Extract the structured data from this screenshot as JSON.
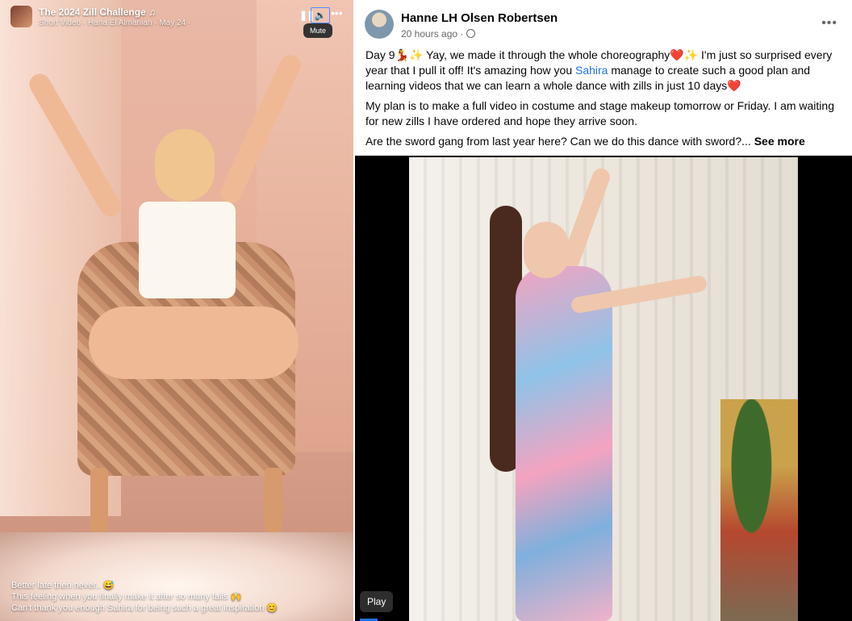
{
  "short_video": {
    "title": "The 2024 Zill Challenge ♫",
    "subtitle": "Short Video · Hana El Almaniah · May 24 ·",
    "controls": {
      "pause": "❚❚",
      "volume": "🔉",
      "more": "•••"
    },
    "tooltip": "Mute",
    "captions": [
      "Better late then never.. 😅",
      "This feeling when you finally make it after so many fails 🙌",
      "Can't thank you enough Sahira for being such a great inspiration 😊"
    ]
  },
  "post": {
    "author": "Hanne LH Olsen Robertsen",
    "time": "20 hours ago ·",
    "more": "•••",
    "paragraph1_a": "Day 9💃✨ Yay, we made it through the whole choreography❤️✨ I'm just so surprised every year that I pull it off! It's amazing how you ",
    "paragraph1_link": "Sahira",
    "paragraph1_b": " manage to create such a good plan and learning videos that we can learn a whole dance with zills in just 10 days❤️",
    "paragraph2": "My plan is to make a full video in costume and stage makeup tomorrow or Friday. I am waiting for new zills I have ordered and hope they arrive soon.",
    "paragraph3": "Are the sword gang from last year here? Can we do this dance with sword?...",
    "see_more": "See more",
    "video": {
      "play_label": "Play"
    }
  }
}
